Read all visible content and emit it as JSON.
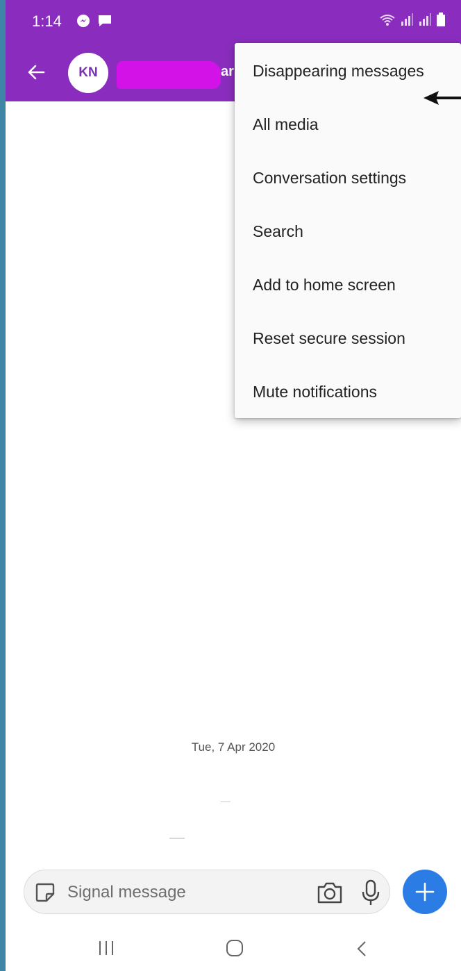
{
  "status_bar": {
    "time": "1:14",
    "left_icons": [
      "messenger-icon",
      "message-icon"
    ],
    "right_icons": [
      "wifi-icon",
      "signal-icon",
      "signal-icon",
      "battery-icon"
    ]
  },
  "app_bar": {
    "avatar_initials": "KN",
    "name_visible_fragment": "ar",
    "name_redacted": true
  },
  "overflow_menu": {
    "items": [
      {
        "label": "Disappearing messages"
      },
      {
        "label": "All media"
      },
      {
        "label": "Conversation settings"
      },
      {
        "label": "Search"
      },
      {
        "label": "Add to home screen"
      },
      {
        "label": "Reset secure session"
      },
      {
        "label": "Mute notifications"
      }
    ]
  },
  "conversation": {
    "date_divider": "Tue, 7 Apr 2020"
  },
  "composer": {
    "placeholder": "Signal message",
    "value": ""
  },
  "colors": {
    "brand": "#8a2dbf",
    "redaction": "#d312e8",
    "fab": "#2c7ce6",
    "background_frame": "#3f86a6"
  }
}
